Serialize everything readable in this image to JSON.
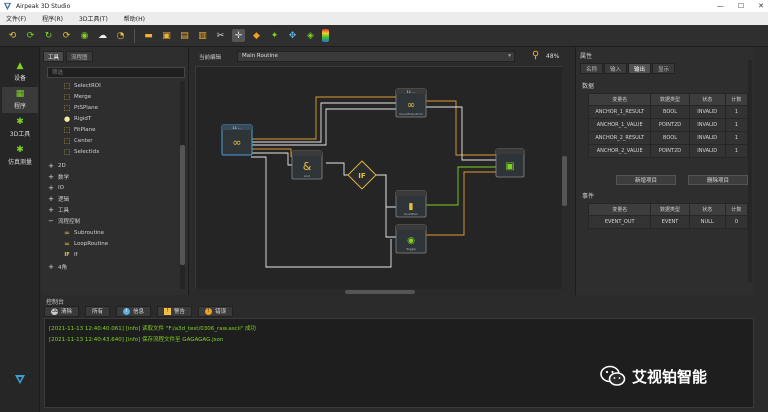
{
  "window": {
    "title": "Airpeak 3D Studio",
    "controls": [
      "—",
      "☐",
      "✕"
    ]
  },
  "menubar": {
    "items": [
      "文件(F)",
      "程序(R)",
      "3D工具(T)",
      "帮助(H)"
    ]
  },
  "toolbar": {
    "icons": [
      "undo-icon",
      "redo-icon",
      "refresh-icon",
      "run-icon",
      "camera-icon",
      "cloud-icon",
      "clock-icon",
      "folder-icon",
      "save-icon",
      "import-icon",
      "export-icon",
      "scissors-icon",
      "crosshair-icon",
      "cube-icon",
      "shapes-icon",
      "move-icon",
      "palette-icon",
      "gradient-icon"
    ]
  },
  "leftnav": {
    "items": [
      {
        "label": "设备",
        "icon": "device-icon",
        "active": false
      },
      {
        "label": "程序",
        "icon": "program-icon",
        "active": true
      },
      {
        "label": "3D工具",
        "icon": "3d-tools-icon",
        "active": false
      },
      {
        "label": "仿真测量",
        "icon": "measure-icon",
        "active": false
      }
    ]
  },
  "toolpanel": {
    "tabs": [
      "工具",
      "流程图"
    ],
    "search_placeholder": "筛选",
    "tree": [
      {
        "label": "SelectROI",
        "kind": "leaf",
        "icon": "roi-icon"
      },
      {
        "label": "Merge",
        "kind": "leaf",
        "icon": "merge-icon"
      },
      {
        "label": "PtSPlane",
        "kind": "leaf",
        "icon": "plane-icon"
      },
      {
        "label": "RigidT",
        "kind": "leaf",
        "icon": "rigid-icon"
      },
      {
        "label": "FitPlane",
        "kind": "leaf",
        "icon": "fitplane-icon"
      },
      {
        "label": "Center",
        "kind": "leaf",
        "icon": "center-icon"
      },
      {
        "label": "SelectIdx",
        "kind": "leaf",
        "icon": "select-idx-icon"
      },
      {
        "label": "2D",
        "kind": "group"
      },
      {
        "label": "数学",
        "kind": "group"
      },
      {
        "label": "IO",
        "kind": "group"
      },
      {
        "label": "逻辑",
        "kind": "group"
      },
      {
        "label": "工具",
        "kind": "group"
      },
      {
        "label": "流程控制",
        "kind": "group-open"
      },
      {
        "label": "Subroutine",
        "kind": "leaf",
        "icon": "subroutine-icon"
      },
      {
        "label": "LoopRoutine",
        "kind": "leaf",
        "icon": "loop-icon"
      },
      {
        "label": "If",
        "kind": "leaf",
        "icon": "if-icon"
      },
      {
        "label": "4角",
        "kind": "group"
      }
    ]
  },
  "canvas": {
    "label": "当前编辑",
    "routine": "Main Routine",
    "zoom": "48%",
    "nodes": [
      {
        "title": "11 ...",
        "footer": "",
        "glyph": "∞"
      },
      {
        "title": "11 ...",
        "footer": "CloudTransform",
        "glyph": "∞"
      },
      {
        "title": "",
        "footer": "And",
        "glyph": "&"
      },
      {
        "title": "",
        "footer": "",
        "glyph": "IF"
      },
      {
        "title": "",
        "footer": "",
        "glyph": "▣"
      },
      {
        "title": "",
        "footer": "Condition",
        "glyph": "▮"
      },
      {
        "title": "",
        "footer": "Toggle",
        "glyph": "◉"
      }
    ]
  },
  "properties": {
    "title": "属性",
    "tabs": [
      "名称",
      "输入",
      "输出",
      "显示"
    ],
    "active_tab": "输出",
    "data_section": "数据",
    "data_headers": [
      "变量名",
      "数据类型",
      "状态",
      "计数"
    ],
    "data_rows": [
      [
        "ANCHOR_1_RESULT",
        "BOOL",
        "INVALID",
        "1"
      ],
      [
        "ANCHOR_1_VALUE",
        "POINT2D",
        "INVALID",
        "1"
      ],
      [
        "ANCHOR_2_RESULT",
        "BOOL",
        "INVALID",
        "1"
      ],
      [
        "ANCHOR_2_VALUE",
        "POINT2D",
        "INVALID",
        "1"
      ]
    ],
    "add_button": "新增项目",
    "delete_button": "删除项目",
    "event_section": "事件",
    "event_headers": [
      "变量名",
      "数据类型",
      "状态",
      "计数"
    ],
    "event_rows": [
      [
        "EVENT_OUT",
        "EVENT",
        "NULL",
        "0"
      ]
    ]
  },
  "console": {
    "label": "控制台",
    "buttons": [
      {
        "label": "清除",
        "icon": "clear-icon"
      },
      {
        "label": "所有",
        "icon": ""
      },
      {
        "label": "信息",
        "icon": "info-icon"
      },
      {
        "label": "警告",
        "icon": "warning-icon"
      },
      {
        "label": "错误",
        "icon": "error-icon"
      }
    ],
    "logs": [
      "[2021-11-13 12:40:40.061] [info] 读取文件 \"F:/a3d_test/0306_raw.ascii\" 成功",
      "[2021-11-13 12:40:43.640] [info] 保存流程文件至 GAGAGAG.json"
    ]
  },
  "watermark": {
    "text": "艾视铂智能",
    "icon": "wechat-icon"
  },
  "colors": {
    "accent_green": "#7ed321",
    "background": "#2b2b2b",
    "node_border": "#5a5a5a",
    "wire_orange": "#e0a030",
    "wire_white": "#e8e8e8"
  }
}
